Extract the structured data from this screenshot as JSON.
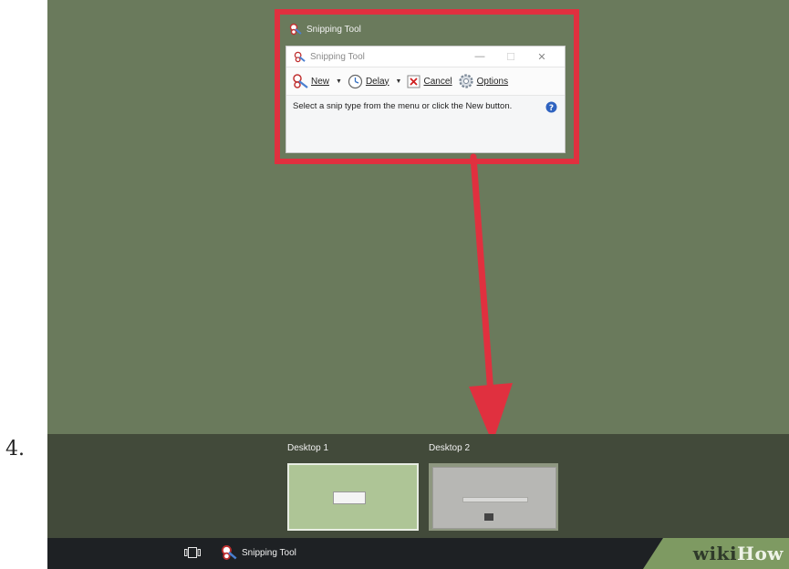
{
  "step": {
    "number": "4."
  },
  "window_card": {
    "title": "Snipping Tool"
  },
  "snipping_tool": {
    "title": "Snipping Tool",
    "controls": {
      "minimize": "—",
      "maximize": "☐",
      "close": "✕"
    },
    "toolbar": {
      "new": "New",
      "delay": "Delay",
      "cancel": "Cancel",
      "options": "Options"
    },
    "status": "Select a snip type from the menu or click the New button."
  },
  "desktops": [
    {
      "label": "Desktop 1"
    },
    {
      "label": "Desktop 2"
    }
  ],
  "taskbar": {
    "app_label": "Snipping Tool"
  },
  "watermark": {
    "wiki": "wiki",
    "how": "How"
  },
  "colors": {
    "highlight": "#e0303f",
    "desktop_bg": "#6a7a5c",
    "strip_bg": "#424a3a",
    "taskbar_bg": "#1e2124"
  }
}
